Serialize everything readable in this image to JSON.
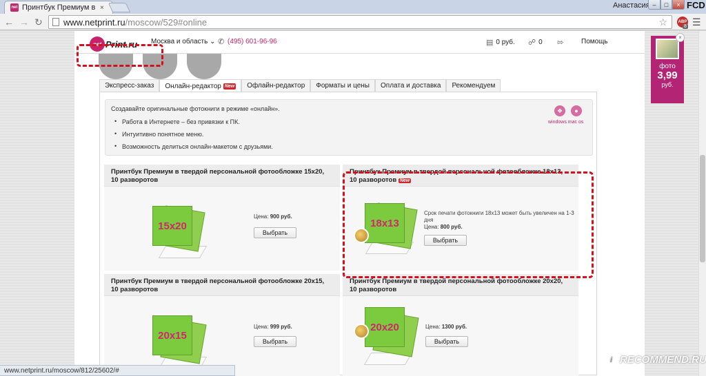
{
  "browser": {
    "tab_title": "Принтбук Премиум в тве",
    "tab_favicon": "net",
    "tab_close": "×",
    "user_name": "Анастасия",
    "win_min": "–",
    "win_max": "□",
    "win_close": "×",
    "fcd": "FCD",
    "url_host": "www.netprint.ru",
    "url_path": "/moscow/529#online",
    "abp_label": "ABP",
    "abp_count": "8",
    "status_url": "www.netprint.ru/moscow/812/25602/#"
  },
  "site": {
    "logo_net": "net",
    "logo_print": "Print.ru",
    "region": "Москва и область",
    "phone": "(495) 601-96-96",
    "money": "0 руб.",
    "cart": "0",
    "help": "Помощь"
  },
  "tabs": [
    {
      "label": "Экспресс-заказ"
    },
    {
      "label": "Онлайн-редактор",
      "badge": "New"
    },
    {
      "label": "Офлайн-редактор"
    },
    {
      "label": "Форматы и цены"
    },
    {
      "label": "Оплата и доставка"
    },
    {
      "label": "Рекомендуем"
    }
  ],
  "intro": {
    "title": "Создавайте оригинальные фотокниги в режиме «онлайн».",
    "items": [
      "Работа в Интернете – без привязки к ПК.",
      "Интуитивно понятное меню.",
      "Возможность делиться онлайн-макетом с друзьями."
    ],
    "os_label": "windows  mac os"
  },
  "products": [
    {
      "title": "Принтбук Премиум в твердой персональной фотообложке 15x20, 10 разворотов",
      "cover": "15x20",
      "price_label": "Цена:",
      "price": "900 руб.",
      "button": "Выбрать"
    },
    {
      "title": "Принтбук Премиум в твердой персональной фотообложке 18x13, 10 разворотов",
      "badge": "New",
      "cover": "18x13",
      "note": "Срок печати фотокниги 18x13 может быть увеличен на 1-3 дня",
      "price_label": "Цена:",
      "price": "800 руб.",
      "button": "Выбрать"
    },
    {
      "title": "Принтбук Премиум в твердой персональной фотообложке 20x15, 10 разворотов",
      "cover": "20x15",
      "price_label": "Цена:",
      "price": "999 руб.",
      "button": "Выбрать"
    },
    {
      "title": "Принтбук Премиум в твердой персональной фотообложке 20x20, 10 разворотов",
      "cover": "20x20",
      "price_label": "Цена:",
      "price": "1300 руб.",
      "button": "Выбрать"
    }
  ],
  "widget": {
    "label": "фото",
    "price": "3,99",
    "unit": "руб.",
    "close": "×"
  },
  "watermark": "RECOMMEND.RU",
  "watermark_badge": "i",
  "colors": {
    "brand": "#c8236a",
    "highlight": "#d40f1e",
    "book_green": "#7ccb3f"
  }
}
